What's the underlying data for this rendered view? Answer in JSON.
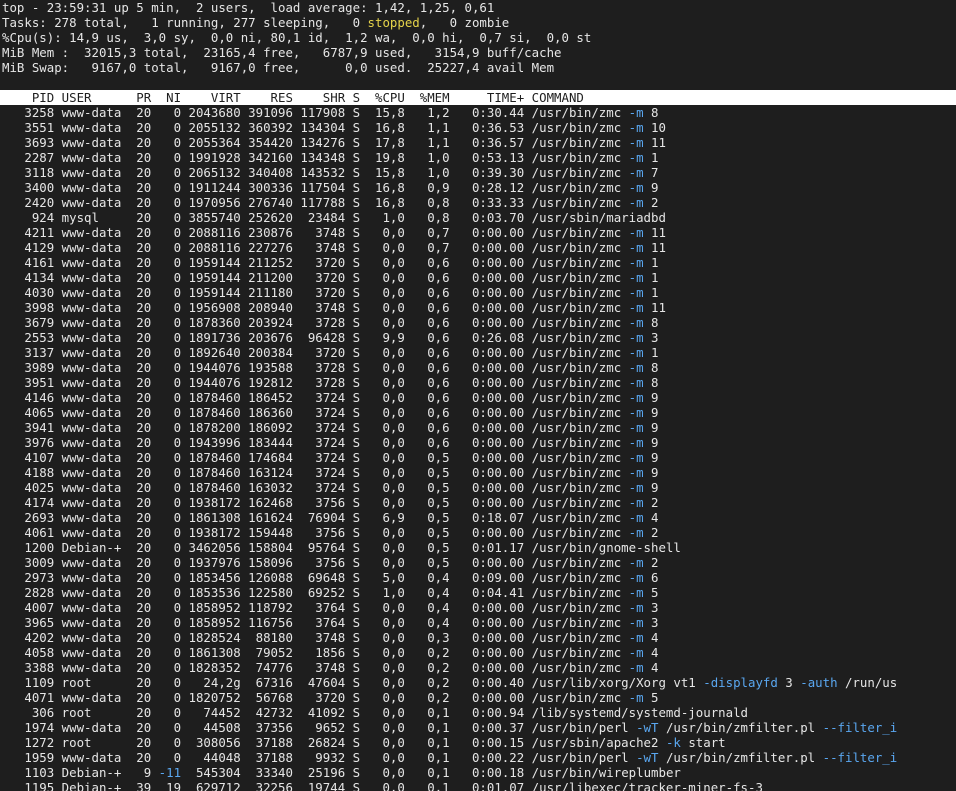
{
  "summary": {
    "uptime_line": "top - 23:59:31 up 5 min,  2 users,  load average: 1,42, 1,25, 0,61",
    "tasks_pre": "Tasks: 278 total,   1 running, 277 sleeping,   0 ",
    "tasks_stopped_word": "stopped",
    "tasks_post": ",   0 zombie",
    "cpu_line": "%Cpu(s): 14,9 us,  3,0 sy,  0,0 ni, 80,1 id,  1,2 wa,  0,0 hi,  0,7 si,  0,0 st",
    "mem_line": "MiB Mem :  32015,3 total,  23165,4 free,   6787,9 used,   3154,9 buff/cache",
    "swap_line": "MiB Swap:   9167,0 total,   9167,0 free,      0,0 used.  25227,4 avail Mem"
  },
  "table": {
    "header": "    PID USER      PR  NI    VIRT    RES    SHR S  %CPU  %MEM     TIME+ COMMAND",
    "rows": [
      {
        "prefix": "   3258 www-data  20   0 2043680 391096 117908 S  15,8   1,2   0:30.44 ",
        "cmd": "/usr/bin/zmc ",
        "flag": "-m",
        "tail": " 8"
      },
      {
        "prefix": "   3551 www-data  20   0 2055132 360392 134304 S  16,8   1,1   0:36.53 ",
        "cmd": "/usr/bin/zmc ",
        "flag": "-m",
        "tail": " 10"
      },
      {
        "prefix": "   3693 www-data  20   0 2055364 354420 134276 S  17,8   1,1   0:36.57 ",
        "cmd": "/usr/bin/zmc ",
        "flag": "-m",
        "tail": " 11"
      },
      {
        "prefix": "   2287 www-data  20   0 1991928 342160 134348 S  19,8   1,0   0:53.13 ",
        "cmd": "/usr/bin/zmc ",
        "flag": "-m",
        "tail": " 1"
      },
      {
        "prefix": "   3118 www-data  20   0 2065132 340408 143532 S  15,8   1,0   0:39.30 ",
        "cmd": "/usr/bin/zmc ",
        "flag": "-m",
        "tail": " 7"
      },
      {
        "prefix": "   3400 www-data  20   0 1911244 300336 117504 S  16,8   0,9   0:28.12 ",
        "cmd": "/usr/bin/zmc ",
        "flag": "-m",
        "tail": " 9"
      },
      {
        "prefix": "   2420 www-data  20   0 1970956 276740 117788 S  16,8   0,8   0:33.33 ",
        "cmd": "/usr/bin/zmc ",
        "flag": "-m",
        "tail": " 2"
      },
      {
        "prefix": "    924 mysql     20   0 3855740 252620  23484 S   1,0   0,8   0:03.70 ",
        "cmd": "/usr/sbin/mariadbd",
        "flag": "",
        "tail": ""
      },
      {
        "prefix": "   4211 www-data  20   0 2088116 230876   3748 S   0,0   0,7   0:00.00 ",
        "cmd": "/usr/bin/zmc ",
        "flag": "-m",
        "tail": " 11"
      },
      {
        "prefix": "   4129 www-data  20   0 2088116 227276   3748 S   0,0   0,7   0:00.00 ",
        "cmd": "/usr/bin/zmc ",
        "flag": "-m",
        "tail": " 11"
      },
      {
        "prefix": "   4161 www-data  20   0 1959144 211252   3720 S   0,0   0,6   0:00.00 ",
        "cmd": "/usr/bin/zmc ",
        "flag": "-m",
        "tail": " 1"
      },
      {
        "prefix": "   4134 www-data  20   0 1959144 211200   3720 S   0,0   0,6   0:00.00 ",
        "cmd": "/usr/bin/zmc ",
        "flag": "-m",
        "tail": " 1"
      },
      {
        "prefix": "   4030 www-data  20   0 1959144 211180   3720 S   0,0   0,6   0:00.00 ",
        "cmd": "/usr/bin/zmc ",
        "flag": "-m",
        "tail": " 1"
      },
      {
        "prefix": "   3998 www-data  20   0 1956908 208940   3748 S   0,0   0,6   0:00.00 ",
        "cmd": "/usr/bin/zmc ",
        "flag": "-m",
        "tail": " 11"
      },
      {
        "prefix": "   3679 www-data  20   0 1878360 203924   3728 S   0,0   0,6   0:00.00 ",
        "cmd": "/usr/bin/zmc ",
        "flag": "-m",
        "tail": " 8"
      },
      {
        "prefix": "   2553 www-data  20   0 1891736 203676  96428 S   9,9   0,6   0:26.08 ",
        "cmd": "/usr/bin/zmc ",
        "flag": "-m",
        "tail": " 3"
      },
      {
        "prefix": "   3137 www-data  20   0 1892640 200384   3720 S   0,0   0,6   0:00.00 ",
        "cmd": "/usr/bin/zmc ",
        "flag": "-m",
        "tail": " 1"
      },
      {
        "prefix": "   3989 www-data  20   0 1944076 193588   3728 S   0,0   0,6   0:00.00 ",
        "cmd": "/usr/bin/zmc ",
        "flag": "-m",
        "tail": " 8"
      },
      {
        "prefix": "   3951 www-data  20   0 1944076 192812   3728 S   0,0   0,6   0:00.00 ",
        "cmd": "/usr/bin/zmc ",
        "flag": "-m",
        "tail": " 8"
      },
      {
        "prefix": "   4146 www-data  20   0 1878460 186452   3724 S   0,0   0,6   0:00.00 ",
        "cmd": "/usr/bin/zmc ",
        "flag": "-m",
        "tail": " 9"
      },
      {
        "prefix": "   4065 www-data  20   0 1878460 186360   3724 S   0,0   0,6   0:00.00 ",
        "cmd": "/usr/bin/zmc ",
        "flag": "-m",
        "tail": " 9"
      },
      {
        "prefix": "   3941 www-data  20   0 1878200 186092   3724 S   0,0   0,6   0:00.00 ",
        "cmd": "/usr/bin/zmc ",
        "flag": "-m",
        "tail": " 9"
      },
      {
        "prefix": "   3976 www-data  20   0 1943996 183444   3724 S   0,0   0,6   0:00.00 ",
        "cmd": "/usr/bin/zmc ",
        "flag": "-m",
        "tail": " 9"
      },
      {
        "prefix": "   4107 www-data  20   0 1878460 174684   3724 S   0,0   0,5   0:00.00 ",
        "cmd": "/usr/bin/zmc ",
        "flag": "-m",
        "tail": " 9"
      },
      {
        "prefix": "   4188 www-data  20   0 1878460 163124   3724 S   0,0   0,5   0:00.00 ",
        "cmd": "/usr/bin/zmc ",
        "flag": "-m",
        "tail": " 9"
      },
      {
        "prefix": "   4025 www-data  20   0 1878460 163032   3724 S   0,0   0,5   0:00.00 ",
        "cmd": "/usr/bin/zmc ",
        "flag": "-m",
        "tail": " 9"
      },
      {
        "prefix": "   4174 www-data  20   0 1938172 162468   3756 S   0,0   0,5   0:00.00 ",
        "cmd": "/usr/bin/zmc ",
        "flag": "-m",
        "tail": " 2"
      },
      {
        "prefix": "   2693 www-data  20   0 1861308 161624  76904 S   6,9   0,5   0:18.07 ",
        "cmd": "/usr/bin/zmc ",
        "flag": "-m",
        "tail": " 4"
      },
      {
        "prefix": "   4061 www-data  20   0 1938172 159448   3756 S   0,0   0,5   0:00.00 ",
        "cmd": "/usr/bin/zmc ",
        "flag": "-m",
        "tail": " 2"
      },
      {
        "prefix": "   1200 Debian-+  20   0 3462056 158804  95764 S   0,0   0,5   0:01.17 ",
        "cmd": "/usr/bin/gnome-shell",
        "flag": "",
        "tail": ""
      },
      {
        "prefix": "   3009 www-data  20   0 1937976 158096   3756 S   0,0   0,5   0:00.00 ",
        "cmd": "/usr/bin/zmc ",
        "flag": "-m",
        "tail": " 2"
      },
      {
        "prefix": "   2973 www-data  20   0 1853456 126088  69648 S   5,0   0,4   0:09.00 ",
        "cmd": "/usr/bin/zmc ",
        "flag": "-m",
        "tail": " 6"
      },
      {
        "prefix": "   2828 www-data  20   0 1853536 122580  69252 S   1,0   0,4   0:04.41 ",
        "cmd": "/usr/bin/zmc ",
        "flag": "-m",
        "tail": " 5"
      },
      {
        "prefix": "   4007 www-data  20   0 1858952 118792   3764 S   0,0   0,4   0:00.00 ",
        "cmd": "/usr/bin/zmc ",
        "flag": "-m",
        "tail": " 3"
      },
      {
        "prefix": "   3965 www-data  20   0 1858952 116756   3764 S   0,0   0,4   0:00.00 ",
        "cmd": "/usr/bin/zmc ",
        "flag": "-m",
        "tail": " 3"
      },
      {
        "prefix": "   4202 www-data  20   0 1828524  88180   3748 S   0,0   0,3   0:00.00 ",
        "cmd": "/usr/bin/zmc ",
        "flag": "-m",
        "tail": " 4"
      },
      {
        "prefix": "   4058 www-data  20   0 1861308  79052   1856 S   0,0   0,2   0:00.00 ",
        "cmd": "/usr/bin/zmc ",
        "flag": "-m",
        "tail": " 4"
      },
      {
        "prefix": "   3388 www-data  20   0 1828352  74776   3748 S   0,0   0,2   0:00.00 ",
        "cmd": "/usr/bin/zmc ",
        "flag": "-m",
        "tail": " 4"
      },
      {
        "prefix": "   1109 root      20   0   24,2g  67316  47604 S   0,0   0,2   0:00.40 ",
        "cmd": "/usr/lib/xorg/Xorg vt1 ",
        "flag": "-displayfd",
        "tail": " 3 ",
        "flag2": "-auth",
        "tail2": " /run/us"
      },
      {
        "prefix": "   4071 www-data  20   0 1820752  56768   3720 S   0,0   0,2   0:00.00 ",
        "cmd": "/usr/bin/zmc ",
        "flag": "-m",
        "tail": " 5"
      },
      {
        "prefix": "    306 root      20   0   74452  42732  41092 S   0,0   0,1   0:00.94 ",
        "cmd": "/lib/systemd/systemd-journald",
        "flag": "",
        "tail": ""
      },
      {
        "prefix": "   1974 www-data  20   0   44508  37356   9652 S   0,0   0,1   0:00.37 ",
        "cmd": "/usr/bin/perl ",
        "flag": "-wT",
        "tail": " /usr/bin/zmfilter.pl ",
        "flag2": "--filter_i",
        "tail2": ""
      },
      {
        "prefix": "   1272 root      20   0  308056  37188  26824 S   0,0   0,1   0:00.15 ",
        "cmd": "/usr/sbin/apache2 ",
        "flag": "-k",
        "tail": " start"
      },
      {
        "prefix": "   1959 www-data  20   0   44048  37188   9932 S   0,0   0,1   0:00.22 ",
        "cmd": "/usr/bin/perl ",
        "flag": "-wT",
        "tail": " /usr/bin/zmfilter.pl ",
        "flag2": "--filter_i",
        "tail2": ""
      },
      {
        "prefix": "   1103 Debian-+   9 ",
        "prefix_hl": "-11",
        "prefix_rest": "  545304  33340  25196 S   0,0   0,1   0:00.18 ",
        "cmd": "/usr/bin/wireplumber",
        "flag": "",
        "tail": ""
      },
      {
        "prefix": "   1195 Debian-+  39  19  629712  32256  19744 S   0,0   0,1   0:01.07 ",
        "cmd": "/usr/libexec/tracker-miner-fs-3",
        "flag": "",
        "tail": ""
      }
    ]
  },
  "colors": {
    "background": "#1e1e1e",
    "foreground": "#e6e6e6",
    "header_bg": "#ffffff",
    "stopped_yellow": "#e5d34a",
    "flag_blue": "#5aa7f0"
  }
}
